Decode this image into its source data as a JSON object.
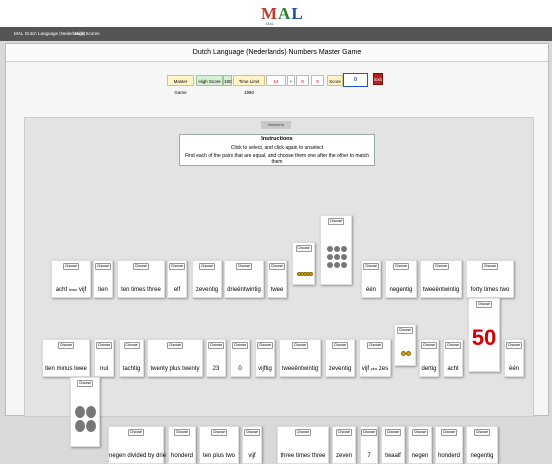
{
  "header": {
    "logo_m": "M",
    "logo_a": "A",
    "logo_l": "L",
    "logo_sub": "MAL"
  },
  "nav": {
    "home": "MAL",
    "item1": "Dutch Language (Nederlands)",
    "item2": "High Scores"
  },
  "page": {
    "title": "Dutch Language (Nederlands) Numbers Master Game"
  },
  "scorebar": {
    "master_game": "Master Game",
    "high_score": "High Score",
    "high_score_val": "190",
    "time_limit": "Time Limit 1980",
    "time_val": "14",
    "plus": "+",
    "hint_val1": "0",
    "hint_val2": "0",
    "score_label": "Score",
    "score_val": "0",
    "exit": "Exit"
  },
  "board": {
    "tab": "Numbers",
    "instructions_title": "Instructions",
    "instructions_line1": "Click to select, and click again to unselect",
    "instructions_line2": "Find each of the pairs that are equal, and choose them one after the other to match them",
    "choose": "Choose"
  },
  "cards": {
    "r1_1": "acht",
    "r1_1b": "times",
    "r1_1c": "vijf",
    "r1_2": "tien",
    "r1_3": "ten times three",
    "r1_4": "elf",
    "r1_5": "zeventig",
    "r1_6": "drieëntwintig",
    "r1_7": "twee",
    "r1_10": "één",
    "r1_11": "negentig",
    "r1_12": "tweeëntwintig",
    "r1_13": "forty times two",
    "r2_1": "tien minus twee",
    "r2_2": "nul",
    "r2_3": "tachtig",
    "r2_4": "twenty plus twenty",
    "r2_5": "23",
    "r2_6": "0",
    "r2_7": "vijftig",
    "r2_8": "tweeëntwintig",
    "r2_9": "zeventig",
    "r2_10a": "vijf",
    "r2_10b": "plus",
    "r2_10c": "zes",
    "r2_12": "dertig",
    "r2_13": "acht",
    "r2_14": "50",
    "r2_15": "één",
    "r3_1": "negen divided by drie",
    "r3_2": "honderd",
    "r3_3": "ten plus two",
    "r3_4": "vijf",
    "r3_5": "three times three",
    "r3_6": "zeven",
    "r3_7": "7",
    "r3_8": "twaalf",
    "r3_9": "negen",
    "r3_10": "honderd",
    "r3_11": "negentig"
  },
  "colors": {
    "score_blue": "#2255cc",
    "exit_red": "#b32020",
    "fifty_red": "#d40000"
  }
}
